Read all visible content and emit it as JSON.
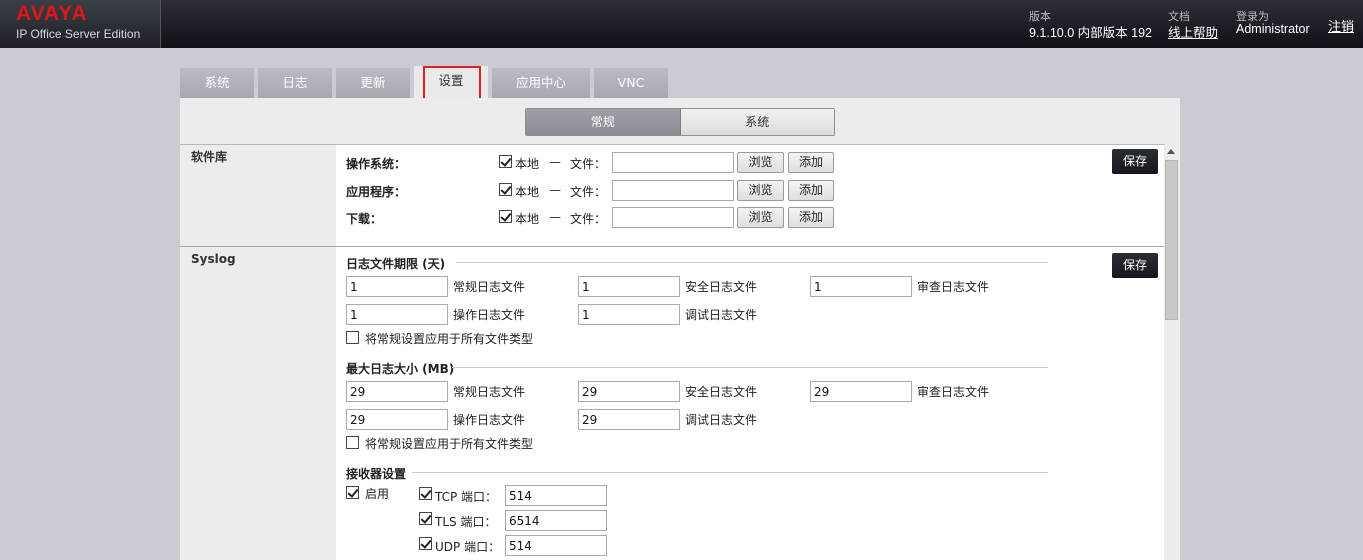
{
  "brand": {
    "logo": "AVAYA",
    "edition": "IP Office Server Edition"
  },
  "header": {
    "version_caption": "版本",
    "version_value": "9.1.10.0 内部版本 192",
    "docs_caption": "文档",
    "docs_link": "线上帮助",
    "login_caption": "登录为",
    "login_user": "Administrator",
    "logout": "注销"
  },
  "tabs": [
    {
      "label": "系统"
    },
    {
      "label": "日志"
    },
    {
      "label": "更新"
    },
    {
      "label": "设置",
      "active": true
    },
    {
      "label": "应用中心"
    },
    {
      "label": "VNC"
    }
  ],
  "subtabs": {
    "general": "常规",
    "system": "系统",
    "selected": "常规"
  },
  "save_label": "保存",
  "software_repo": {
    "title": "软件库",
    "local_label": "本地",
    "dash": "—",
    "file_label": "文件：",
    "browse_label": "浏览",
    "add_label": "添加",
    "rows": [
      {
        "label": "操作系统：",
        "local_checked": true,
        "file": ""
      },
      {
        "label": "应用程序：",
        "local_checked": true,
        "file": ""
      },
      {
        "label": "下载：",
        "local_checked": true,
        "file": ""
      }
    ]
  },
  "syslog": {
    "title": "Syslog",
    "retention": {
      "title": "日志文件期限 (天)",
      "general_label": "常规日志文件",
      "general": "1",
      "security_label": "安全日志文件",
      "security": "1",
      "audit_label": "审查日志文件",
      "audit": "1",
      "operation_label": "操作日志文件",
      "operation": "1",
      "debug_label": "调试日志文件",
      "debug": "1",
      "apply_all": "将常规设置应用于所有文件类型",
      "apply_all_checked": false
    },
    "maxsize": {
      "title": "最大日志大小 (MB)",
      "general_label": "常规日志文件",
      "general": "29",
      "security_label": "安全日志文件",
      "security": "29",
      "audit_label": "审查日志文件",
      "audit": "29",
      "operation_label": "操作日志文件",
      "operation": "29",
      "debug_label": "调试日志文件",
      "debug": "29",
      "apply_all": "将常规设置应用于所有文件类型",
      "apply_all_checked": false
    },
    "receiver": {
      "title": "接收器设置",
      "enable_label": "启用",
      "enable_checked": true,
      "tcp_label": "TCP 端口：",
      "tcp_checked": true,
      "tcp": "514",
      "tls_label": "TLS 端口：",
      "tls_checked": true,
      "tls": "6514",
      "udp_label": "UDP 端口：",
      "udp_checked": true,
      "udp": "514"
    }
  },
  "colors": {
    "highlight_box": "#e02020",
    "logo_red": "#e0161b",
    "save_button": "#1d1f24"
  }
}
